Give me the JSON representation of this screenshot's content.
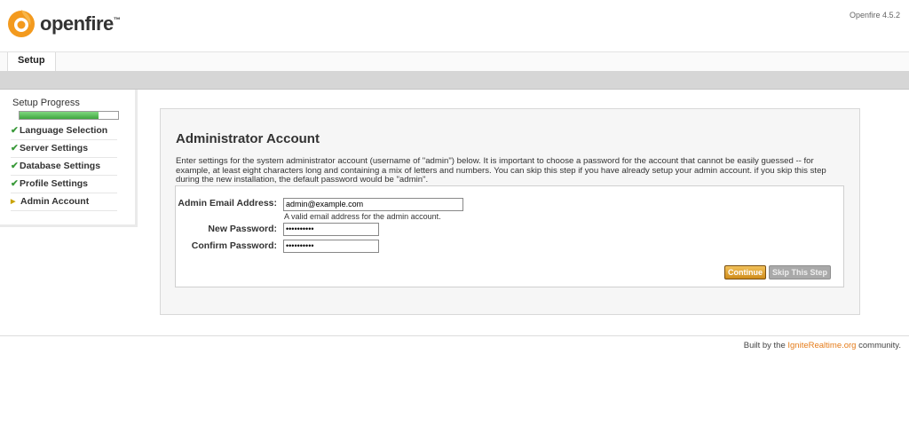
{
  "header": {
    "app_name": "openfire",
    "trademark": "™",
    "version": "Openfire 4.5.2"
  },
  "tabs": [
    {
      "label": "Setup"
    }
  ],
  "sidebar": {
    "title": "Setup Progress",
    "progress_fraction": 0.8,
    "steps": [
      {
        "label": "Language Selection",
        "status": "done"
      },
      {
        "label": "Server Settings",
        "status": "done"
      },
      {
        "label": "Database Settings",
        "status": "done"
      },
      {
        "label": "Profile Settings",
        "status": "done"
      },
      {
        "label": "Admin Account",
        "status": "current"
      }
    ]
  },
  "main": {
    "title": "Administrator Account",
    "intro": "Enter settings for the system administrator account (username of \"admin\") below. It is important to choose a password for the account that cannot be easily guessed -- for example, at least eight characters long and containing a mix of letters and numbers. You can skip this step if you have already setup your admin account. if you skip this step during the new installation, the default password would be \"admin\".",
    "form": {
      "email_label": "Admin Email Address:",
      "email_value": "admin@example.com",
      "email_hint": "A valid email address for the admin account.",
      "new_password_label": "New Password:",
      "new_password_value": "••••••••••",
      "confirm_password_label": "Confirm Password:",
      "confirm_password_value": "••••••••••"
    },
    "buttons": {
      "continue": "Continue",
      "skip": "Skip This Step"
    }
  },
  "footer": {
    "prefix": "Built by the ",
    "link": "IgniteRealtime.org",
    "suffix": " community."
  },
  "colors": {
    "accent": "#e57c1a",
    "progress": "#5cb85c",
    "check": "#3a9a3a"
  }
}
